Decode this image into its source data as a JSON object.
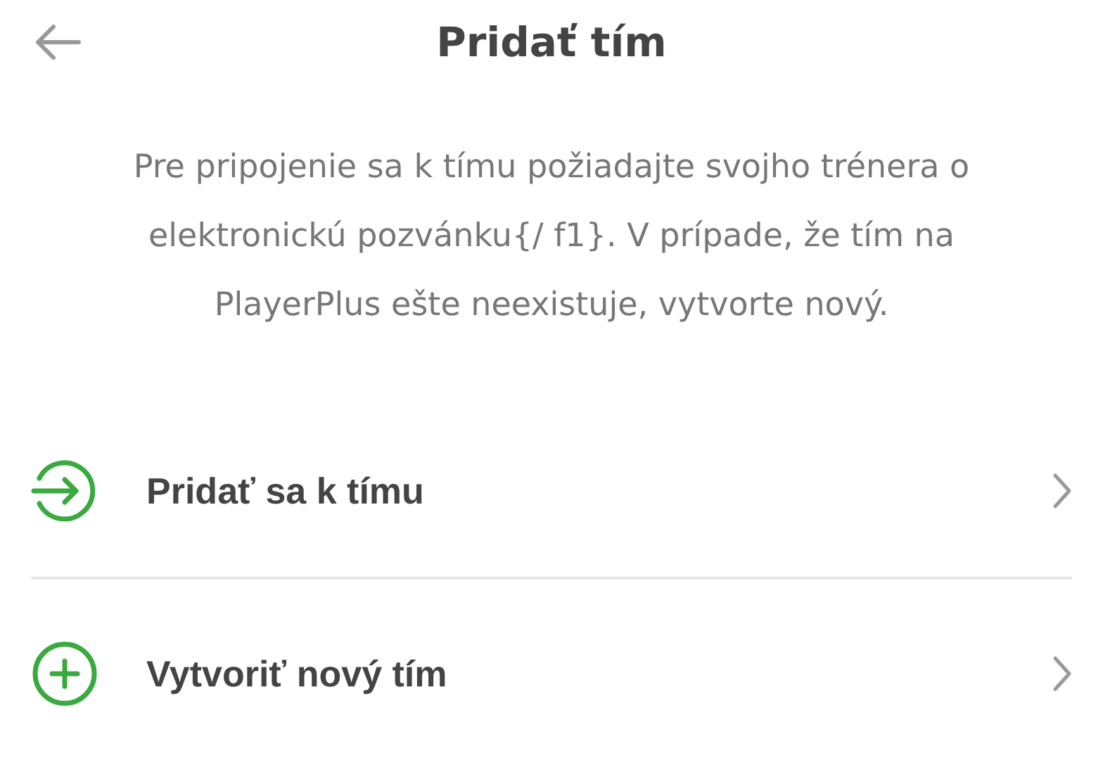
{
  "header": {
    "title": "Pridať tím"
  },
  "description": "Pre pripojenie sa k tímu požiadajte svojho trénera o elektronickú pozvánku{/ f1}. V prípade, že tím na PlayerPlus ešte neexistuje, vytvorte nový.",
  "options": [
    {
      "kind": "join",
      "label": "Pridať sa k tímu"
    },
    {
      "kind": "create",
      "label": "Vytvoriť nový tím"
    }
  ]
}
